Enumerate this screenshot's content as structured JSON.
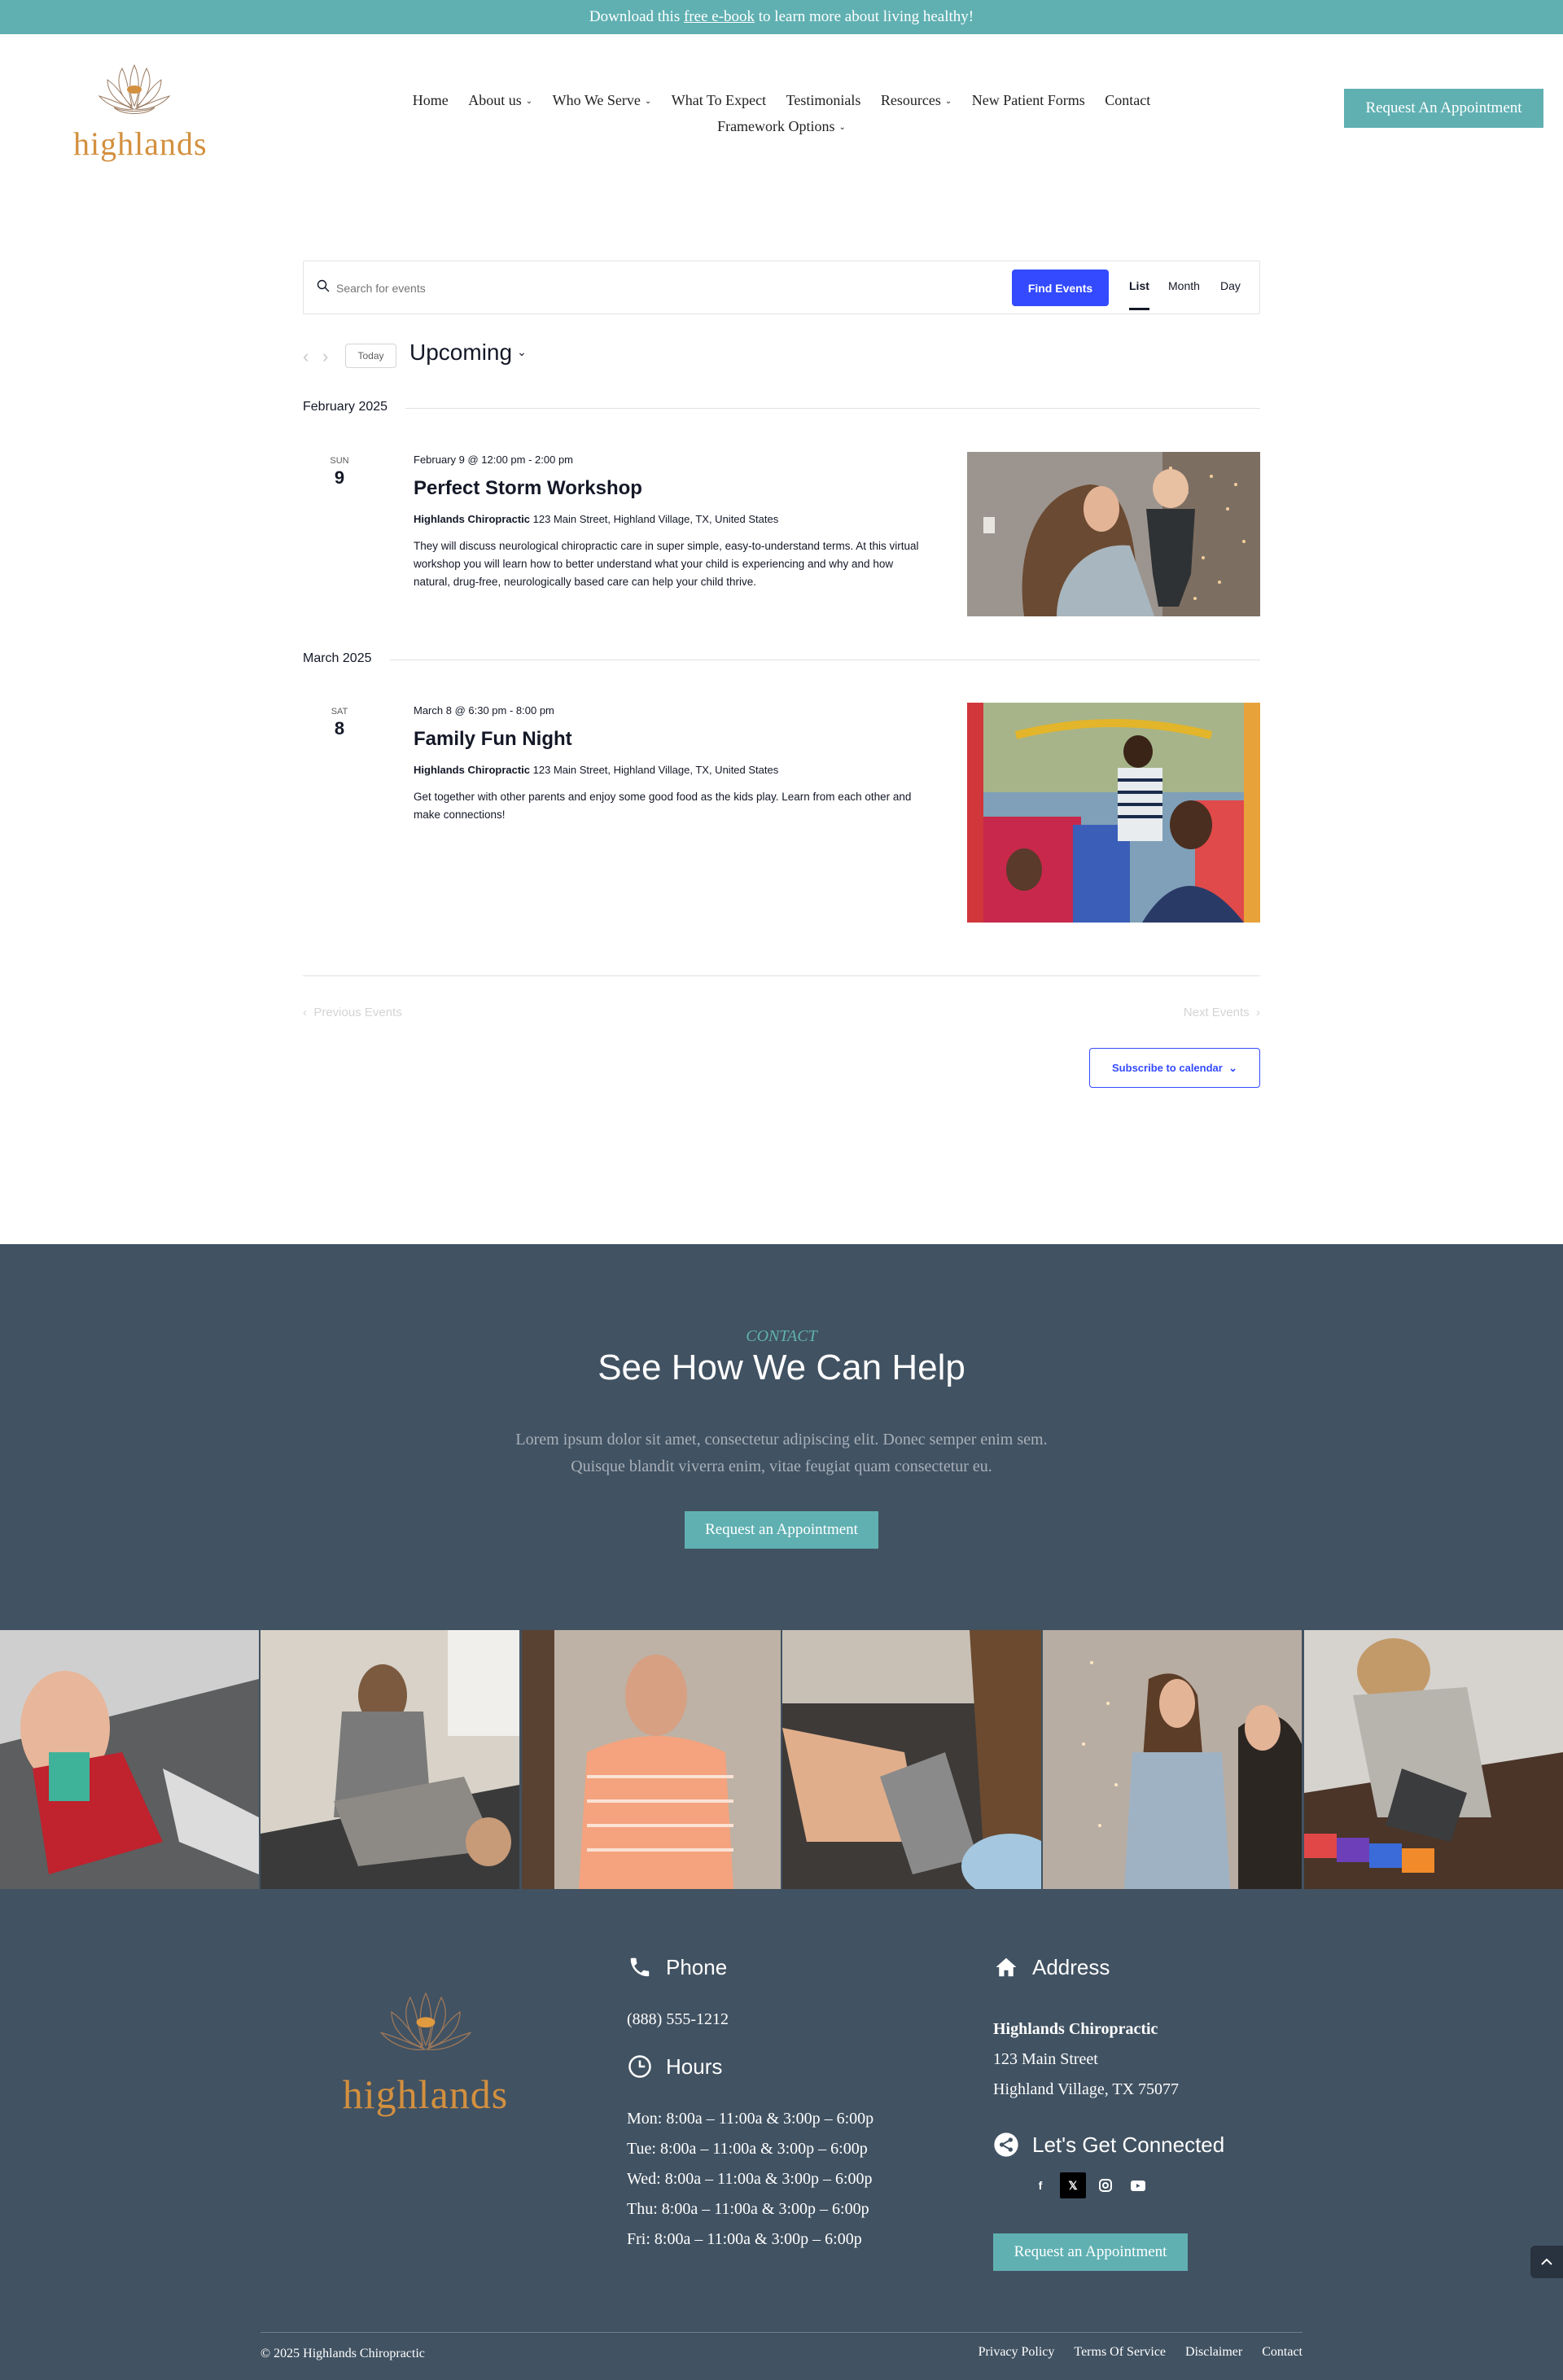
{
  "topbar": {
    "prefix": "Download this ",
    "link": "free e-book",
    "suffix": " to learn more about living healthy!"
  },
  "brand": {
    "name": "highlands"
  },
  "nav": {
    "items": [
      {
        "label": "Home",
        "dropdown": false
      },
      {
        "label": "About us",
        "dropdown": true
      },
      {
        "label": "Who We Serve",
        "dropdown": true
      },
      {
        "label": "What To Expect",
        "dropdown": false
      },
      {
        "label": "Testimonials",
        "dropdown": false
      },
      {
        "label": "Resources",
        "dropdown": true
      },
      {
        "label": "New Patient Forms",
        "dropdown": false
      },
      {
        "label": "Contact",
        "dropdown": false
      }
    ],
    "second_row": {
      "label": "Framework Options",
      "dropdown": true
    },
    "cta": "Request An Appointment"
  },
  "events_bar": {
    "search_placeholder": "Search for events",
    "find_button": "Find Events",
    "views": [
      "List",
      "Month",
      "Day"
    ],
    "active_view": "List"
  },
  "date_nav": {
    "today": "Today",
    "range_label": "Upcoming"
  },
  "months": [
    {
      "label": "February 2025",
      "events": [
        {
          "dow": "SUN",
          "day": "9",
          "time": "February 9 @ 12:00 pm - 2:00 pm",
          "title": "Perfect Storm Workshop",
          "venue_name": "Highlands Chiropractic",
          "venue_address": " 123 Main Street, Highland Village, TX, United States",
          "description": "They will discuss neurological chiropractic care in super simple, easy-to-understand terms. At this virtual workshop you will learn how to better understand what your child is experiencing and why and how natural, drug-free, neurologically based care can help your child thrive.",
          "image": "mother-lifting-baby-photo"
        }
      ]
    },
    {
      "label": "March 2025",
      "events": [
        {
          "dow": "SAT",
          "day": "8",
          "time": "March 8 @ 6:30 pm - 8:00 pm",
          "title": "Family Fun Night",
          "venue_name": "Highlands Chiropractic",
          "venue_address": " 123 Main Street, Highland Village, TX, United States",
          "description": "Get together with other parents and enjoy some good food as the kids play. Learn from each other and make connections!",
          "image": "family-playground-photo"
        }
      ]
    }
  ],
  "pager": {
    "previous": "Previous Events",
    "next": "Next Events"
  },
  "subscribe": "Subscribe to calendar",
  "contact": {
    "kicker": "CONTACT",
    "title": "See How We Can Help",
    "text_line1": "Lorem ipsum dolor sit amet, consectetur adipiscing elit. Donec semper enim sem.",
    "text_line2": "Quisque blandit viverra enim, vitae feugiat quam consectetur eu.",
    "button": "Request an Appointment"
  },
  "gallery": [
    "baby-with-toy",
    "adjustment-on-table",
    "older-man-talking",
    "adjusting-instrument",
    "staff-smiling",
    "child-playing-tiles"
  ],
  "footer": {
    "phone_heading": "Phone",
    "phone": "(888) 555-1212",
    "hours_heading": "Hours",
    "hours": [
      "Mon: 8:00a – 11:00a & 3:00p – 6:00p",
      "Tue: 8:00a – 11:00a & 3:00p – 6:00p",
      "Wed: 8:00a – 11:00a & 3:00p – 6:00p",
      "Thu: 8:00a – 11:00a & 3:00p – 6:00p",
      "Fri: 8:00a – 11:00a & 3:00p – 6:00p"
    ],
    "address_heading": "Address",
    "address_name": "Highlands Chiropractic",
    "address_line1": "123 Main Street",
    "address_line2": "Highland Village, TX 75077",
    "social_heading": "Let's Get Connected",
    "social": [
      "facebook",
      "x",
      "instagram",
      "youtube"
    ],
    "button": "Request an Appointment",
    "copyright": "© 2025 Highlands Chiropractic",
    "links": [
      "Privacy Policy",
      "Terms Of Service",
      "Disclaimer",
      "Contact"
    ]
  },
  "colors": {
    "teal": "#60b0b2",
    "blue": "#334aff",
    "navy": "#415262",
    "gold": "#d3903f"
  }
}
